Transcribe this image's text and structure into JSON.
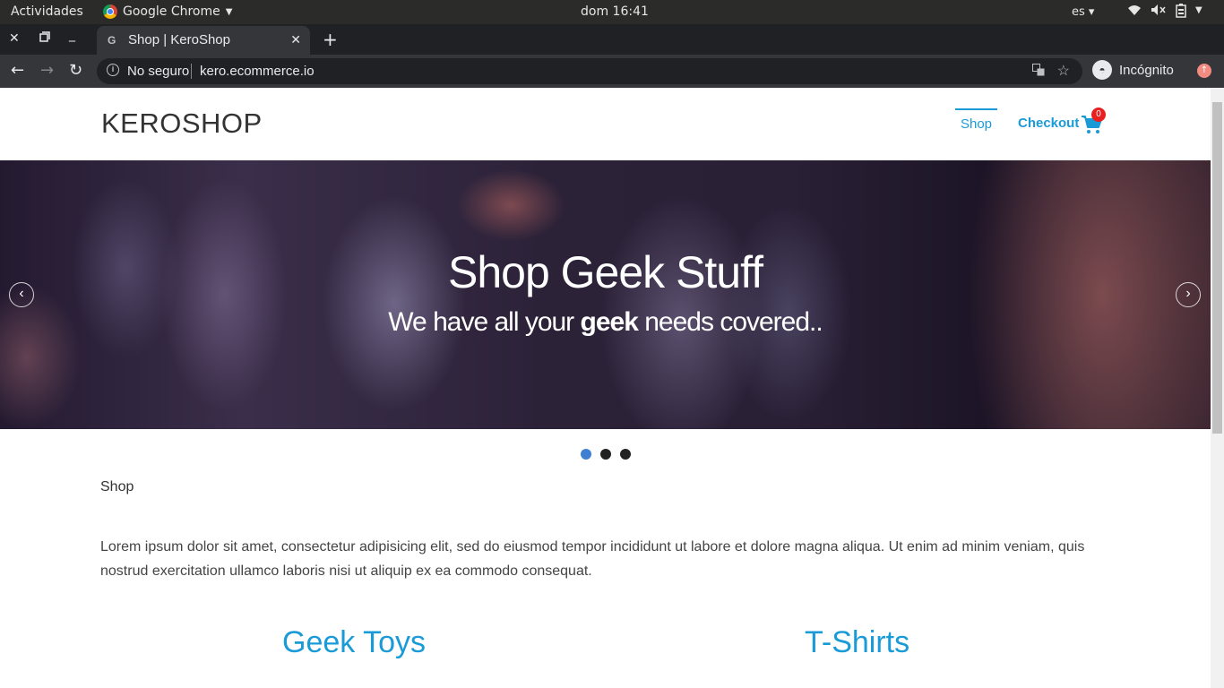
{
  "os_bar": {
    "activities": "Actividades",
    "app_name": "Google Chrome",
    "clock": "dom 16:41",
    "lang": "es"
  },
  "browser": {
    "tab_title": "Shop | KeroShop",
    "tab_favicon": "G",
    "security_label": "No seguro",
    "url": "kero.ecommerce.io",
    "profile_label": "Incógnito"
  },
  "site": {
    "brand": "KEROSHOP",
    "nav": {
      "shop": "Shop",
      "checkout": "Checkout",
      "cart_count": "0"
    },
    "hero": {
      "title": "Shop Geek Stuff",
      "subtitle_pre": "We have all your ",
      "subtitle_emphasis": "geek",
      "subtitle_post": " needs covered..",
      "slide_count": 3,
      "active_slide": 1
    },
    "breadcrumb": "Shop",
    "intro": "Lorem ipsum dolor sit amet, consectetur adipisicing elit, sed do eiusmod tempor incididunt ut labore et dolore magna aliqua. Ut enim ad minim veniam, quis nostrud exercitation ullamco laboris nisi ut aliquip ex ea commodo consequat.",
    "categories": [
      "Geek Toys",
      "T-Shirts"
    ]
  },
  "colors": {
    "accent": "#1a9bd7",
    "badge": "#e82020",
    "active_dot": "#3f7fd1"
  },
  "icons": [
    "chrome-logo-icon",
    "caret-down-icon",
    "wifi-icon",
    "volume-mute-icon",
    "battery-icon",
    "close-icon",
    "restore-icon",
    "minimize-icon",
    "plus-icon",
    "back-arrow-icon",
    "forward-arrow-icon",
    "reload-icon",
    "info-icon",
    "translate-icon",
    "star-icon",
    "incognito-icon",
    "update-icon",
    "cart-icon",
    "chevron-left-icon",
    "chevron-right-icon"
  ]
}
